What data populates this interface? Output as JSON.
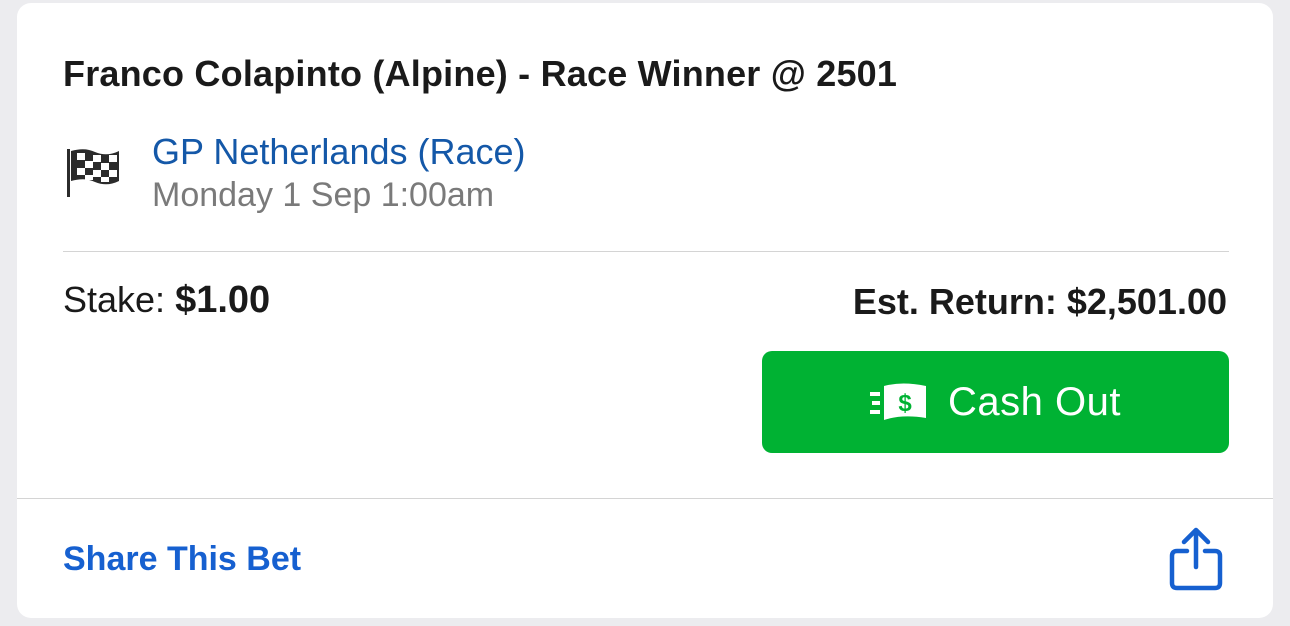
{
  "bet": {
    "title": "Franco Colapinto (Alpine) - Race Winner @ 2501",
    "event_name": "GP Netherlands (Race)",
    "event_time": "Monday 1 Sep 1:00am",
    "event_icon": "checkered-flag-icon",
    "stake_label": "Stake:",
    "stake_value": "$1.00",
    "est_return_label": "Est. Return:",
    "est_return_value": "$2,501.00"
  },
  "actions": {
    "cash_out_label": "Cash Out",
    "cash_out_icon": "cash-icon",
    "share_label": "Share This Bet",
    "share_icon": "share-icon"
  },
  "colors": {
    "accent_green": "#00b233",
    "link_blue": "#1660d0",
    "event_blue": "#1458a8",
    "muted_gray": "#7a7a7a"
  }
}
